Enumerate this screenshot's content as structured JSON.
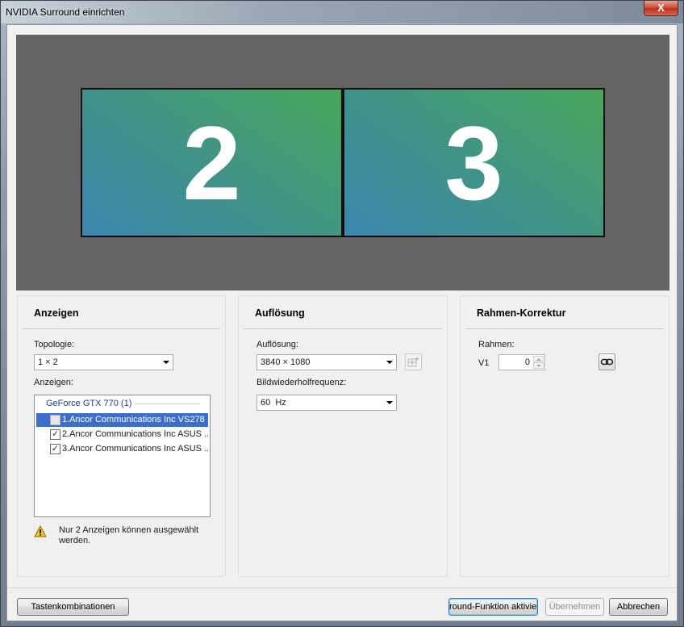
{
  "window": {
    "title": "NVIDIA Surround einrichten",
    "close_label": "X"
  },
  "preview": {
    "monitors": [
      {
        "label": "2"
      },
      {
        "label": "3"
      }
    ]
  },
  "displays_panel": {
    "title": "Anzeigen",
    "topology_label": "Topologie:",
    "topology_value": "1 × 2",
    "displays_label": "Anzeigen:",
    "gpu_group": "GeForce GTX 770 (1)",
    "items": [
      {
        "label": "1.Ancor Communications Inc VS278",
        "checked": false,
        "selected": true,
        "enabled": false
      },
      {
        "label": "2.Ancor Communications Inc ASUS ...",
        "checked": true,
        "selected": false,
        "enabled": true
      },
      {
        "label": "3.Ancor Communications Inc ASUS ...",
        "checked": true,
        "selected": false,
        "enabled": true
      }
    ],
    "warning": "Nur 2 Anzeigen können ausgewählt werden."
  },
  "resolution_panel": {
    "title": "Auflösung",
    "resolution_label": "Auflösung:",
    "resolution_value": "3840 × 1080",
    "refresh_label": "Bildwiederholfrequenz:",
    "refresh_value": "60  Hz"
  },
  "bezel_panel": {
    "title": "Rahmen-Korrektur",
    "bezel_label": "Rahmen:",
    "v1_label": "V1",
    "v1_value": "0"
  },
  "footer": {
    "hotkeys_label": "Tastenkombinationen",
    "enable_label": "round-Funktion aktivier",
    "apply_label": "Übernehmen",
    "cancel_label": "Abbrechen"
  },
  "colors": {
    "monitor_gradient_start": "#3c86b0",
    "monitor_gradient_end": "#47a65a",
    "preview_bg": "#646464",
    "selection": "#3d6fca",
    "group_header": "#1c3f95"
  }
}
